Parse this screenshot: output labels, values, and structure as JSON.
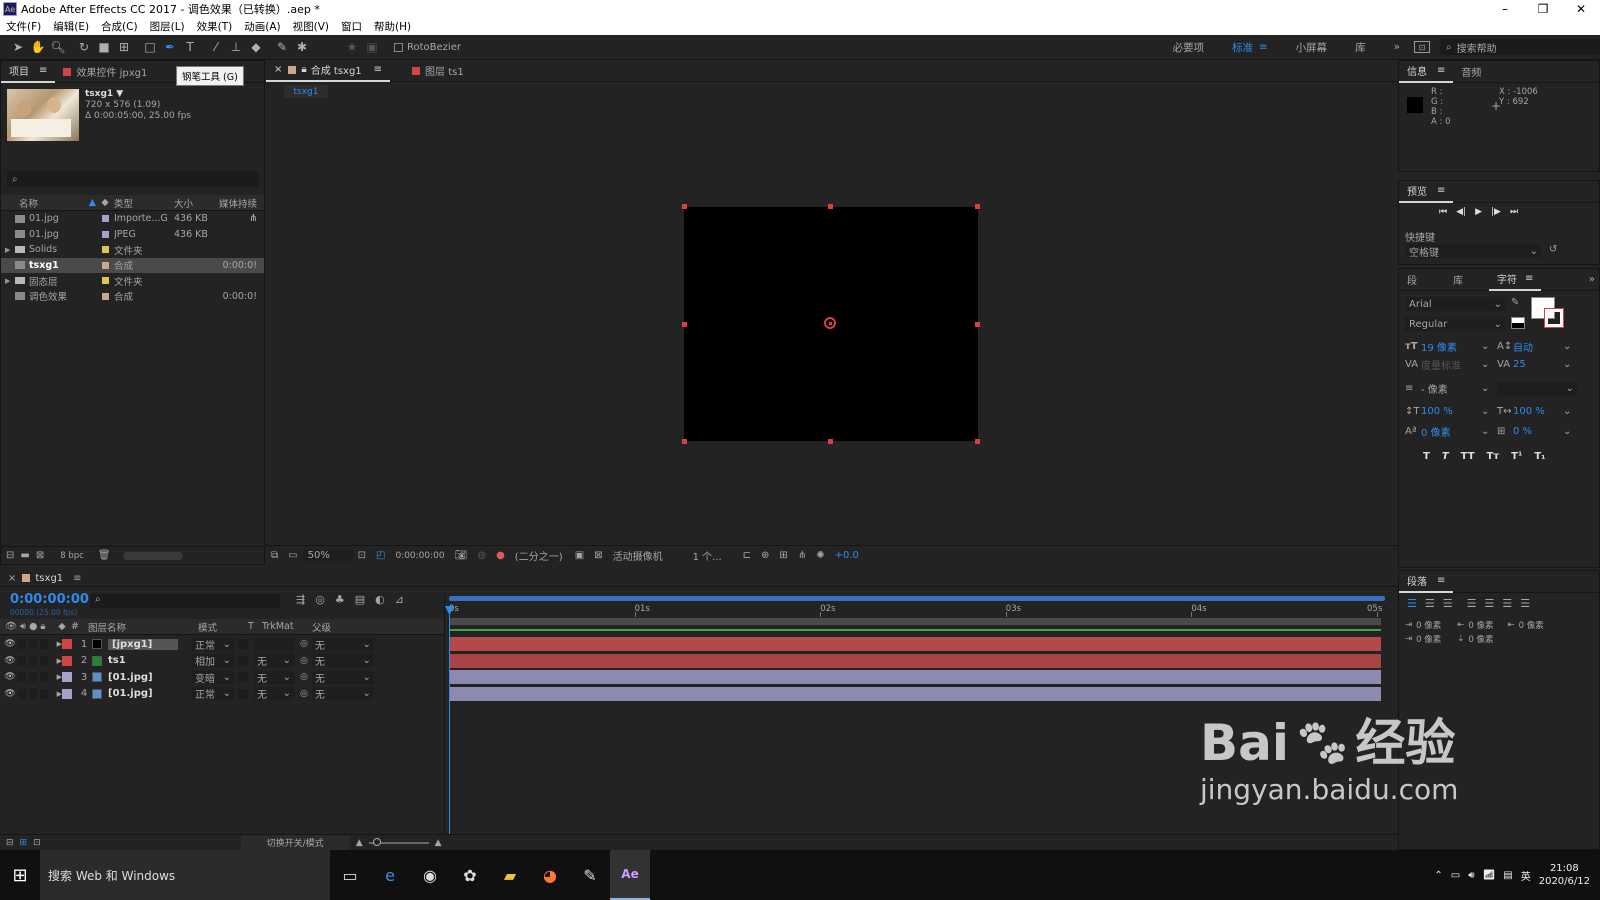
{
  "window": {
    "title": "Adobe After Effects CC 2017 - 调色效果（已转换）.aep *",
    "app_icon": "Ae"
  },
  "menu": [
    "文件(F)",
    "编辑(E)",
    "合成(C)",
    "图层(L)",
    "效果(T)",
    "动画(A)",
    "视图(V)",
    "窗口",
    "帮助(H)"
  ],
  "toolbar": {
    "rotobezier": "RotoBezier",
    "workspaces": [
      "必要项",
      "标准",
      "小屏幕",
      "库"
    ],
    "active_workspace": "标准",
    "search_placeholder": "搜索帮助",
    "tooltip": "钢笔工具 (G)"
  },
  "project": {
    "tabs": [
      "项目",
      "效果控件 jpxg1"
    ],
    "preview": {
      "name": "tsxg1 ▼",
      "dims": "720 x 576 (1.09)",
      "duration": "Δ 0:00:05:00, 25.00 fps"
    },
    "columns": [
      "名称",
      "类型",
      "大小",
      "媒体持续"
    ],
    "bpc": "8 bpc",
    "items": [
      {
        "name": "01.jpg",
        "type": "Importe...G",
        "size": "436 KB",
        "dur": "",
        "label": "#a9a0c8",
        "kind": "file"
      },
      {
        "name": "01.jpg",
        "type": "JPEG",
        "size": "436 KB",
        "dur": "",
        "label": "#a9a0c8",
        "kind": "file"
      },
      {
        "name": "Solids",
        "type": "文件夹",
        "size": "",
        "dur": "",
        "label": "#e0c64a",
        "kind": "folder"
      },
      {
        "name": "tsxg1",
        "type": "合成",
        "size": "",
        "dur": "0:00:0!",
        "label": "#c9a88a",
        "kind": "comp",
        "selected": true
      },
      {
        "name": "固态层",
        "type": "文件夹",
        "size": "",
        "dur": "",
        "label": "#e0c64a",
        "kind": "folder"
      },
      {
        "name": "调色效果",
        "type": "合成",
        "size": "",
        "dur": "0:00:0!",
        "label": "#c9a88a",
        "kind": "comp"
      }
    ]
  },
  "composition": {
    "tabs": [
      "合成 tsxg1",
      "图层 ts1"
    ],
    "breadcrumb": "tsxg1",
    "zoom": "50%",
    "timecode": "0:00:00:00",
    "resolution": "(二分之一)",
    "camera": "活动摄像机",
    "views": "1 个...",
    "exposure": "+0.0"
  },
  "timeline": {
    "tab": "tsxg1",
    "timecode": "0:00:00:00",
    "fps": "00000 (25.00 fps)",
    "columns": [
      "#",
      "图层名称",
      "模式",
      "T",
      "TrkMat",
      "父级"
    ],
    "ruler": [
      "0s",
      "01s",
      "02s",
      "03s",
      "04s",
      "05s"
    ],
    "footer": "切换开关/模式",
    "layers": [
      {
        "num": "1",
        "name": "[jpxg1]",
        "mode": "正常",
        "trk": "",
        "parent": "无",
        "color": "#d04545",
        "bar": "#b54848"
      },
      {
        "num": "2",
        "name": "ts1",
        "mode": "相加",
        "trk": "无",
        "parent": "无",
        "color": "#d04545",
        "bar": "#a94444"
      },
      {
        "num": "3",
        "name": "[01.jpg]",
        "mode": "变暗",
        "trk": "无",
        "parent": "无",
        "color": "#a9a0c8",
        "bar": "#8d8ab0"
      },
      {
        "num": "4",
        "name": "[01.jpg]",
        "mode": "正常",
        "trk": "无",
        "parent": "无",
        "color": "#a9a0c8",
        "bar": "#8d8ab0"
      }
    ]
  },
  "info": {
    "tabs": [
      "信息",
      "音频"
    ],
    "r": "R :",
    "g": "G :",
    "b": "B :",
    "a": "A : 0",
    "x": "X : -1006",
    "y": "Y : 692"
  },
  "preview_panel": {
    "title": "预览",
    "shortcut_label": "快捷键",
    "shortcut": "空格键"
  },
  "character": {
    "tabs": [
      "段",
      "库",
      "字符"
    ],
    "font": "Arial",
    "style": "Regular",
    "size": "19 像素",
    "leading": "自动",
    "kerning": "度量标准",
    "tracking": "25",
    "stroke": "- 像素",
    "vscale": "100 %",
    "hscale": "100 %",
    "baseline": "0 像素",
    "tsume": "0 %",
    "styles": [
      "T",
      "T",
      "TT",
      "Tт",
      "T¹",
      "T₁"
    ]
  },
  "paragraph": {
    "title": "段落",
    "indent_left": "0 像素",
    "indent_top": "0 像素",
    "indent_right": "0 像素",
    "indent_first": "0 像素",
    "space_after": "0 像素"
  },
  "taskbar": {
    "search": "搜索 Web 和 Windows",
    "ime": "英",
    "time": "21:08",
    "date": "2020/6/12"
  },
  "watermark": {
    "brand": "Bai",
    "brand2": "经验",
    "url": "jingyan.baidu.com"
  }
}
